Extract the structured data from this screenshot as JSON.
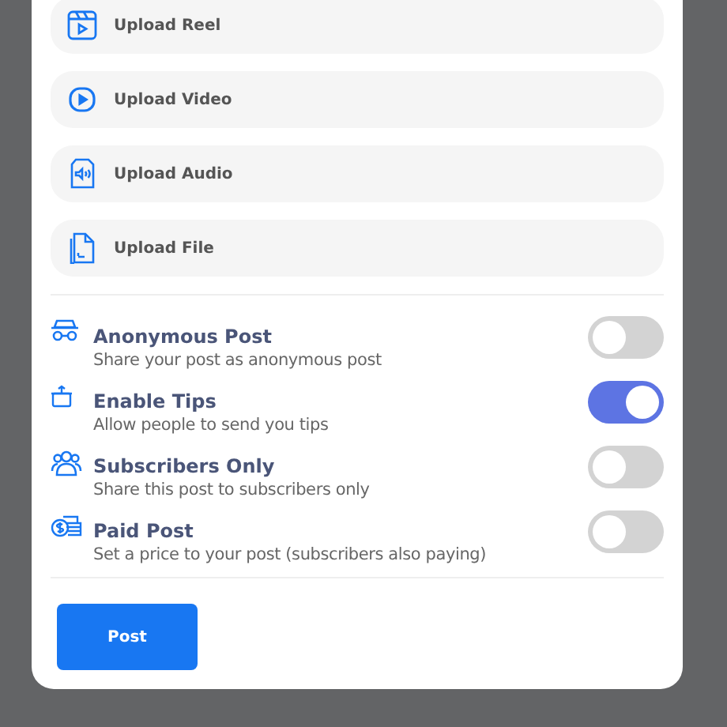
{
  "uploads": [
    {
      "kind": "reel",
      "label": "Upload Reel"
    },
    {
      "kind": "video",
      "label": "Upload Video"
    },
    {
      "kind": "audio",
      "label": "Upload Audio"
    },
    {
      "kind": "file",
      "label": "Upload File"
    }
  ],
  "options": [
    {
      "kind": "anonymous",
      "title": "Anonymous Post",
      "description": "Share your post as anonymous post",
      "on": false
    },
    {
      "kind": "tips",
      "title": "Enable Tips",
      "description": "Allow people to send you tips",
      "on": true
    },
    {
      "kind": "subscribers",
      "title": "Subscribers Only",
      "description": "Share this post to subscribers only",
      "on": false
    },
    {
      "kind": "paid",
      "title": "Paid Post",
      "description": "Set a price to your post (subscribers also paying)",
      "on": false
    }
  ],
  "submit": {
    "label": "Post"
  }
}
